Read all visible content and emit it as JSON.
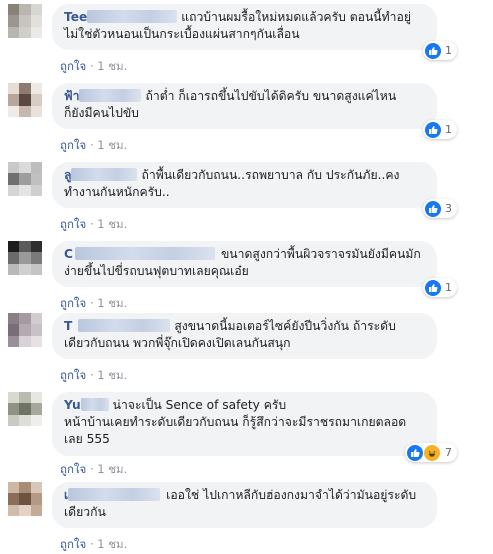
{
  "like_label": "ถูกใจ",
  "separator": "·",
  "colors": {
    "author": "#385898",
    "bubble": "#f2f3f5",
    "like_blue": "#1877f2",
    "haha_yellow": "#f7b125"
  },
  "comments": [
    {
      "author": "Tee",
      "blurred": true,
      "line1": "แถวบ้านผมรื้อใหม่หมดแล้วครับ ตอนนี้ทำอยู่",
      "line2": "ไม่ใช่ตัวหนอนเป็นกระเบื้องแผ่นสากๆกันเลื่อน",
      "time": "1 ชม.",
      "reaction_count": "1",
      "reactions": [
        "like-icon"
      ]
    },
    {
      "author": "ฟ้า",
      "blurred": true,
      "line1": "ถ้าต่ำ ก็เอารถขึ้นไปขับได้ดิครับ ขนาดสูงแค่ไหน",
      "line2": "ก็ยังมีคนไปขับ",
      "time": "1 ชม.",
      "reaction_count": "1",
      "reactions": [
        "like-icon"
      ]
    },
    {
      "author": "ลู",
      "blurred": true,
      "line1": "ถ้าพื้นเดียวกับถนน..รถพยาบาล กับ ประกันภัย..คง",
      "line2": "ทำงานกันหนักครับ..",
      "time": "1 ชม.",
      "reaction_count": "3",
      "reactions": [
        "like-icon"
      ]
    },
    {
      "author": "C",
      "blurred": true,
      "line1": "ขนาดสูงกว่าพื้นผิวจราจรมันยังมีคนมัก",
      "line2": "ง่ายขึ้นไปขี่รถบนฟุตบาทเลยคุณเอ๋ย",
      "time": "1 ชม.",
      "reaction_count": "1",
      "reactions": [
        "like-icon"
      ]
    },
    {
      "author": "T",
      "blurred": true,
      "line1": "สูงขนาดนี้มอเตอร์ไซค์ยังปีนวิ่งกัน ถ้าระดับ",
      "line2": "เดียวกับถนน พวกพี่จุ๊กเปิดคงเปิดเลนกันสนุก",
      "time": "1 ชม.",
      "reaction_count": "",
      "reactions": []
    },
    {
      "author": "Yu",
      "blurred": true,
      "line1": "น่าจะเป็น Sence of safety ครับ",
      "line2": "หน้าบ้านเคยทำระดับเดียวกับถนน ก็รู้สึกว่าจะมีราชรถมาเกยตลอด",
      "line3": "เลย 555",
      "time": "1 ชม.",
      "reaction_count": "7",
      "reactions": [
        "like-icon",
        "haha-icon"
      ]
    },
    {
      "author": "เ",
      "blurred": true,
      "line1": "เออใช่ ไปเกาหลีกับฮ่องกงมาจำได้ว่ามันอยู่ระดับ",
      "line2": "เดียวกัน",
      "time": "1 ชม.",
      "reaction_count": "",
      "reactions": []
    }
  ]
}
